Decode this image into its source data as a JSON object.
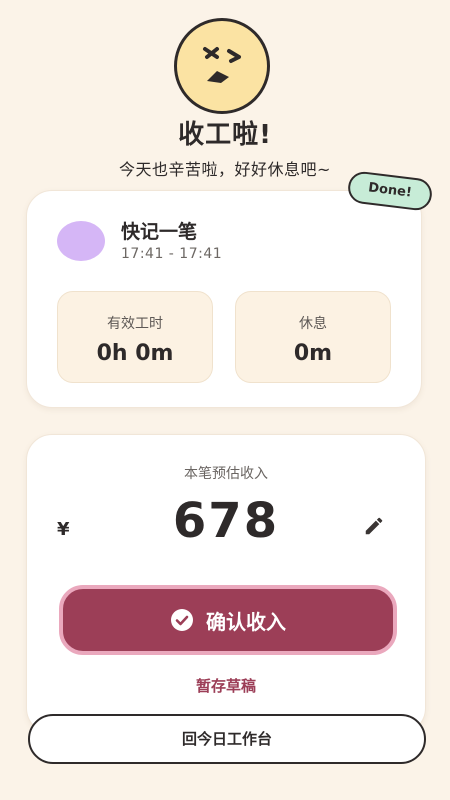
{
  "header": {
    "title": "收工啦!",
    "subtitle": "今天也辛苦啦，好好休息吧~",
    "mascot_icon": "tired-face-icon"
  },
  "session_card": {
    "badge": "Done!",
    "task_name": "快记一笔",
    "time_range": "17:41 - 17:41",
    "avatar_color": "#d5b6f6",
    "stats": [
      {
        "label": "有效工时",
        "value": "0h 0m"
      },
      {
        "label": "休息",
        "value": "0m"
      }
    ]
  },
  "income_card": {
    "label": "本笔预估收入",
    "currency": "¥",
    "amount": "678",
    "edit_icon": "pencil-icon",
    "confirm_label": "确认收入",
    "confirm_icon": "check-circle-icon",
    "draft_label": "暂存草稿"
  },
  "footer": {
    "back_label": "回今日工作台"
  },
  "colors": {
    "background": "#fbf3e8",
    "accent": "#9c3e57",
    "badge": "#c7ecd7",
    "mascot": "#fbe3a3"
  }
}
